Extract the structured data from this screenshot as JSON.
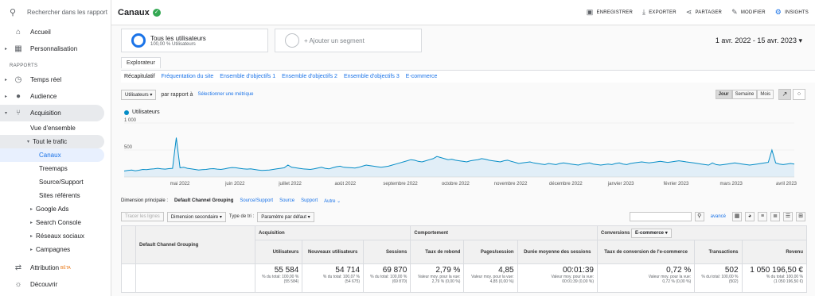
{
  "sidebar": {
    "search_placeholder": "Rechercher dans les rapport",
    "home": "Accueil",
    "customization": "Personnalisation",
    "reports_label": "RAPPORTS",
    "realtime": "Temps réel",
    "audience": "Audience",
    "acquisition": "Acquisition",
    "overview": "Vue d'ensemble",
    "all_traffic": "Tout le trafic",
    "channels": "Canaux",
    "treemaps": "Treemaps",
    "source_medium": "Source/Support",
    "referrals": "Sites référents",
    "google_ads": "Google Ads",
    "search_console": "Search Console",
    "social": "Réseaux sociaux",
    "campaigns": "Campagnes",
    "attribution": "Attribution",
    "beta": "BÊTA",
    "discover": "Découvrir"
  },
  "header": {
    "title": "Canaux",
    "save": "ENREGISTRER",
    "export": "EXPORTER",
    "share": "PARTAGER",
    "edit": "MODIFIER",
    "insights": "INSIGHTS"
  },
  "segments": {
    "all_users": "Tous les utilisateurs",
    "all_users_pct": "100,00 % Utilisateurs",
    "add_segment": "+ Ajouter un segment",
    "date_range": "1 avr. 2022 - 15 avr. 2023"
  },
  "tabs": {
    "explorer": "Explorateur",
    "subtabs": [
      "Récapitulatif",
      "Fréquentation du site",
      "Ensemble d'objectifs 1",
      "Ensemble d'objectifs 2",
      "Ensemble d'objectifs 3",
      "E-commerce"
    ]
  },
  "controls": {
    "metric": "Utilisateurs",
    "vs": "par rapport à",
    "select_metric": "Sélectionner une métrique",
    "day": "Jour",
    "week": "Semaine",
    "month": "Mois"
  },
  "chart_data": {
    "type": "line",
    "series": [
      {
        "name": "Utilisateurs"
      }
    ],
    "y_ticks": [
      "1 000",
      "500"
    ],
    "ylim": [
      0,
      1000
    ],
    "x_labels": [
      "mai 2022",
      "juin 2022",
      "juillet 2022",
      "août 2022",
      "septembre 2022",
      "octobre 2022",
      "novembre 2022",
      "décembre 2022",
      "janvier 2023",
      "février 2023",
      "mars 2023",
      "avril 2023"
    ],
    "values": [
      110,
      120,
      130,
      115,
      125,
      140,
      135,
      145,
      150,
      160,
      150,
      145,
      155,
      160,
      730,
      170,
      180,
      160,
      150,
      140,
      130,
      135,
      140,
      150,
      155,
      145,
      140,
      150,
      165,
      175,
      170,
      160,
      150,
      145,
      150,
      140,
      130,
      120,
      125,
      130,
      140,
      150,
      160,
      170,
      220,
      180,
      170,
      160,
      150,
      145,
      140,
      150,
      165,
      180,
      160,
      150,
      170,
      190,
      200,
      180,
      175,
      170,
      165,
      180,
      200,
      220,
      210,
      200,
      190,
      180,
      190,
      200,
      220,
      240,
      260,
      280,
      300,
      320,
      310,
      290,
      280,
      300,
      320,
      340,
      380,
      360,
      340,
      320,
      330,
      310,
      300,
      290,
      280,
      300,
      310,
      320,
      340,
      330,
      310,
      300,
      290,
      280,
      300,
      310,
      290,
      270,
      250,
      260,
      270,
      280,
      260,
      250,
      240,
      230,
      250,
      240,
      230,
      250,
      260,
      250,
      240,
      230,
      220,
      240,
      250,
      260,
      240,
      230,
      220,
      230,
      240,
      230,
      250,
      260,
      240,
      230,
      250,
      260,
      270,
      280,
      270,
      260,
      270,
      280,
      290,
      280,
      270,
      280,
      290,
      300,
      290,
      280,
      270,
      260,
      250,
      240,
      230,
      220,
      260,
      230,
      220,
      230,
      240,
      250,
      260,
      250,
      240,
      230,
      220,
      230,
      240,
      250,
      260,
      270,
      500,
      260,
      240,
      230,
      240,
      250,
      240
    ]
  },
  "dimension": {
    "label": "Dimension principale :",
    "primary": "Default Channel Grouping",
    "others": [
      "Source/Support",
      "Source",
      "Support",
      "Autre ⌄"
    ]
  },
  "tools": {
    "plot_rows": "Tracer les lignes",
    "secondary_dim": "Dimension secondaire",
    "sort_type": "Type de tri :",
    "default_param": "Paramètre par défaut",
    "advanced": "avancé"
  },
  "table": {
    "groups": {
      "acquisition": "Acquisition",
      "behavior": "Comportement",
      "conversions": "Conversions",
      "ecommerce": "E-commerce"
    },
    "headers": [
      "Default Channel Grouping",
      "Utilisateurs",
      "Nouveaux utilisateurs",
      "Sessions",
      "Taux de rebond",
      "Pages/session",
      "Durée moyenne des sessions",
      "Taux de conversion de l'e-commerce",
      "Transactions",
      "Revenu"
    ],
    "totals": [
      {
        "value": "55 584",
        "sub1": "% du total: 100,00 %",
        "sub2": "(55 584)"
      },
      {
        "value": "54 714",
        "sub1": "% du total: 100,07 %",
        "sub2": "(54 675)"
      },
      {
        "value": "69 870",
        "sub1": "% du total: 100,00 %",
        "sub2": "(69 870)"
      },
      {
        "value": "2,79 %",
        "sub1": "Valeur moy. pour la vue:",
        "sub2": "2,79 % (0,00 %)"
      },
      {
        "value": "4,85",
        "sub1": "Valeur moy. pour la vue:",
        "sub2": "4,85 (0,00 %)"
      },
      {
        "value": "00:01:39",
        "sub1": "Valeur moy. pour la vue:",
        "sub2": "00:01:39 (0,00 %)"
      },
      {
        "value": "0,72 %",
        "sub1": "Valeur moy. pour la vue:",
        "sub2": "0,72 % (0,00 %)"
      },
      {
        "value": "502",
        "sub1": "% du total: 100,00 %",
        "sub2": "(502)"
      },
      {
        "value": "1 050 196,50 €",
        "sub1": "% du total: 100,00 %",
        "sub2": "(1 050 196,50 €)"
      }
    ]
  }
}
